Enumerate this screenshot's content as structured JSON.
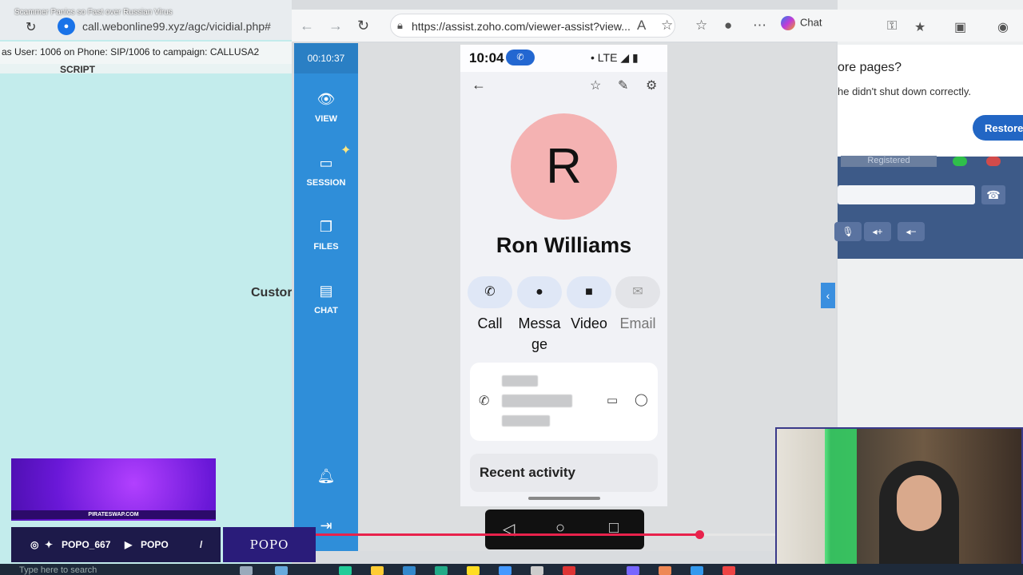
{
  "video_title": "Scammer Panics so Fast over Russian Virus",
  "left_browser": {
    "url": "call.webonline99.xyz/agc/vicidial.php#",
    "agent_info": "as User: 1006 on Phone: SIP/1006  to campaign: CALLUSA2",
    "script_tab": "SCRIPT",
    "partial_label": "Custor"
  },
  "viewer_browser": {
    "url": "https://assist.zoho.com/viewer-assist?view...",
    "chat_label": "Chat"
  },
  "viewer_sidebar": {
    "timer": "00:10:37",
    "items": [
      {
        "label": "VIEW",
        "icon": "eye-icon"
      },
      {
        "label": "SESSION",
        "icon": "monitor-icon"
      },
      {
        "label": "FILES",
        "icon": "files-icon"
      },
      {
        "label": "CHAT",
        "icon": "chat-bubble-icon"
      }
    ]
  },
  "phone": {
    "time": "10:04",
    "network": "LTE",
    "avatar_letter": "R",
    "contact_name": "Ron Williams",
    "actions": [
      {
        "label": "Call",
        "icon": "phone-icon",
        "enabled": true
      },
      {
        "label": "Message",
        "icon": "message-icon",
        "enabled": true
      },
      {
        "label": "Video",
        "icon": "video-icon",
        "enabled": true
      },
      {
        "label": "Email",
        "icon": "email-icon",
        "enabled": false
      }
    ],
    "recent_activity": "Recent activity"
  },
  "right_browser": {
    "restore_heading": "ore pages?",
    "restore_text": "he didn't shut down correctly.",
    "restore_button": "Restore",
    "registered_label": "Registered"
  },
  "overlay": {
    "promo_site": "PIRATESWAP.COM",
    "handle_1": "POPO_667",
    "handle_2": "POPO",
    "brand": "POPO"
  },
  "taskbar": {
    "search_placeholder": "Type here to search"
  },
  "video_progress": 0.835
}
